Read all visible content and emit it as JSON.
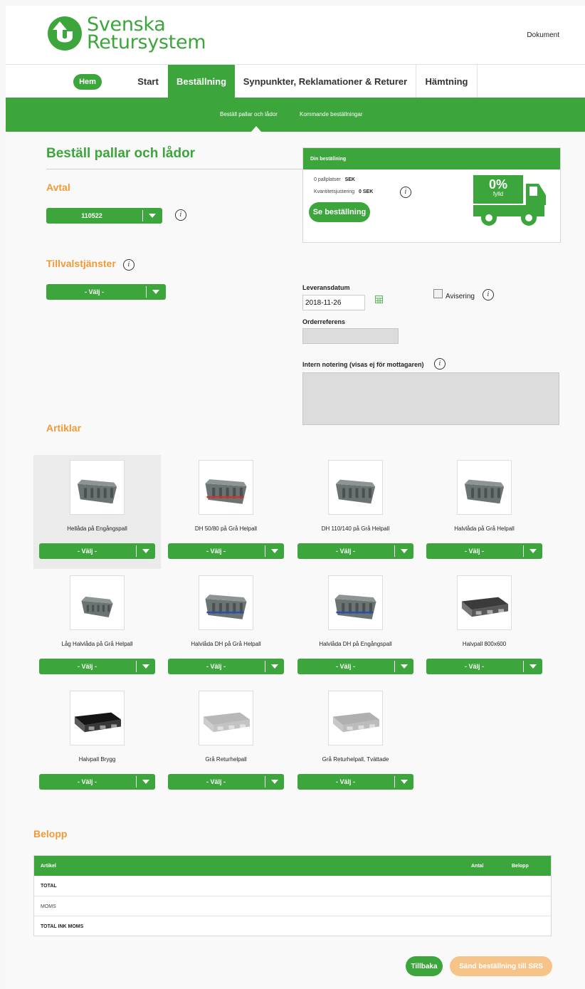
{
  "header": {
    "logo_line1": "Svenska",
    "logo_line2": "Retursystem",
    "link_dokument": "Dokument"
  },
  "nav": {
    "hem": "Hem",
    "start": "Start",
    "bestallning": "Beställning",
    "synpunkter": "Synpunkter, Reklamationer & Returer",
    "hamtning": "Hämtning"
  },
  "subnav": {
    "bestall": "Beställ pallar och lådor",
    "kommande": "Kommande beställningar"
  },
  "page_title": "Beställ pallar och lådor",
  "avtal": {
    "heading": "Avtal",
    "value": "110522"
  },
  "tillval": {
    "heading": "Tillvalstjänster",
    "value": "- Välj -"
  },
  "order": {
    "heading": "Din beställning",
    "pallplatser_label": "0 pallplatser",
    "pallplatser_value": "SEK",
    "kvantitet_label": "Kvantitetsjustering",
    "kvantitet_value": "0 SEK",
    "se_button": "Se beställning",
    "truck_percent": "0%",
    "truck_label": "fylld"
  },
  "form": {
    "leverans_label": "Leveransdatum",
    "leverans_value": "2018-11-26",
    "avisering_label": "Avisering",
    "orderref_label": "Orderreferens",
    "orderref_value": "",
    "intern_label": "Intern notering (visas ej för mottagaren)",
    "intern_value": ""
  },
  "artiklar": {
    "heading": "Artiklar",
    "select_label": "- Välj -",
    "items": [
      {
        "name": "Hellåda på Engångspall"
      },
      {
        "name": "DH 50/80 på Grå Helpall"
      },
      {
        "name": "DH 110/140 på Grå Helpall"
      },
      {
        "name": "Halvlåda på Grå Helpall"
      },
      {
        "name": "Låg Halvlåda på Grå Helpall"
      },
      {
        "name": "Halvlåda DH på Grå Helpall"
      },
      {
        "name": "Halvlåda DH på Engångspall"
      },
      {
        "name": "Halvpall 800x600"
      },
      {
        "name": "Halvpall Brygg"
      },
      {
        "name": "Grå Returhelpall"
      },
      {
        "name": "Grå Returhelpall, Tvättade"
      }
    ]
  },
  "belopp": {
    "heading": "Belopp",
    "col_artikel": "Artikel",
    "col_antal": "Antal",
    "col_belopp": "Belopp",
    "row_total": "TOTAL",
    "row_moms": "MOMS",
    "row_total_ink": "TOTAL INK MOMS"
  },
  "actions": {
    "tillbaka": "Tillbaka",
    "sand": "Sänd beställning till SRS"
  },
  "colors": {
    "brand_green": "#3ca53c",
    "accent_orange": "#f09a37",
    "disabled_orange": "#f6c489"
  }
}
